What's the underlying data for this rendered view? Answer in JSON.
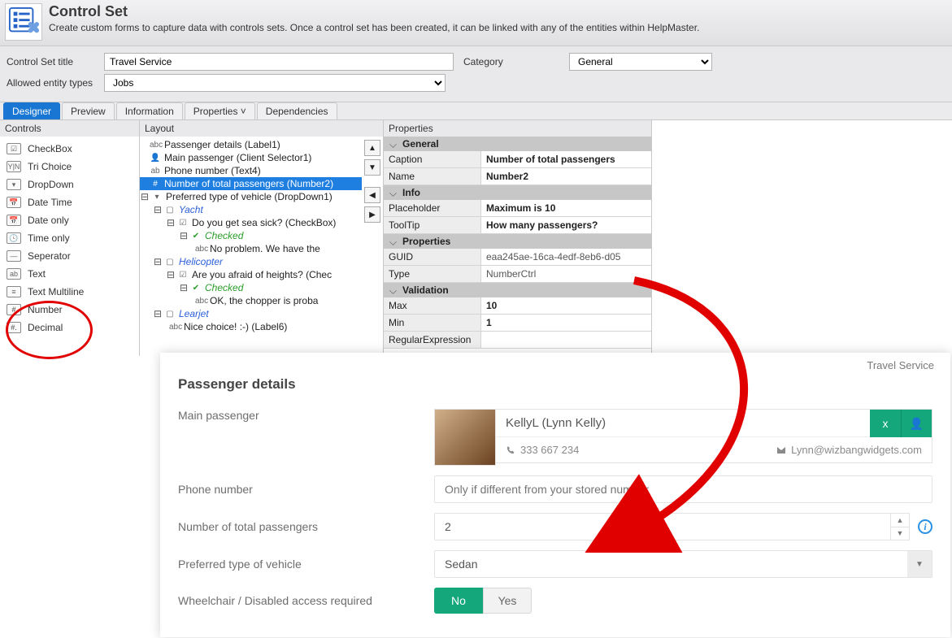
{
  "app": {
    "title": "Control Set",
    "description": "Create custom forms to capture data with controls sets.  Once a control set has been created, it can be linked with any of the entities within HelpMaster."
  },
  "config": {
    "title_label": "Control Set title",
    "title_value": "Travel Service",
    "category_label": "Category",
    "category_value": "General",
    "entity_label": "Allowed entity types",
    "entity_value": "Jobs"
  },
  "tabs": {
    "designer": "Designer",
    "preview": "Preview",
    "information": "Information",
    "properties": "Properties ˅",
    "dependencies": "Dependencies"
  },
  "panels": {
    "controls": "Controls",
    "layout": "Layout",
    "properties": "Properties"
  },
  "controls": {
    "checkbox": "CheckBox",
    "trichoice": "Tri Choice",
    "dropdown": "DropDown",
    "datetime": "Date Time",
    "dateonly": "Date only",
    "timeonly": "Time only",
    "seperator": "Seperator",
    "text": "Text",
    "multiline": "Text Multiline",
    "number": "Number",
    "decimal": "Decimal"
  },
  "layout": {
    "n0": "Passenger details (Label1)",
    "n1": "Main passenger (Client Selector1)",
    "n2": "Phone number (Text4)",
    "n3": "Number of total passengers (Number2)",
    "n4": "Preferred type of vehicle (DropDown1)",
    "yacht": "Yacht",
    "yacht_q": "Do you get sea sick? (CheckBox)",
    "yacht_checked": "Checked",
    "yacht_ok": "No problem.  We have the",
    "heli": "Helicopter",
    "heli_q": "Are you afraid of heights? (Chec",
    "heli_checked": "Checked",
    "heli_ok": "OK, the chopper is proba",
    "lear": "Learjet",
    "lear_ok": "Nice choice! :-) (Label6)"
  },
  "prop": {
    "general": "General",
    "caption_k": "Caption",
    "caption_v": "Number of total passengers",
    "name_k": "Name",
    "name_v": "Number2",
    "info": "Info",
    "ph_k": "Placeholder",
    "ph_v": "Maximum is 10",
    "tt_k": "ToolTip",
    "tt_v": "How many passengers?",
    "props": "Properties",
    "guid_k": "GUID",
    "guid_v": "eaa245ae-16ca-4edf-8eb6-d05",
    "type_k": "Type",
    "type_v": "NumberCtrl",
    "validation": "Validation",
    "max_k": "Max",
    "max_v": "10",
    "min_k": "Min",
    "min_v": "1",
    "regex_k": "RegularExpression"
  },
  "form": {
    "service": "Travel Service",
    "heading": "Passenger details",
    "main_label": "Main passenger",
    "contact_name": "KellyL (Lynn Kelly)",
    "phone": "333 667 234",
    "email": "Lynn@wizbangwidgets.com",
    "phone_label": "Phone number",
    "phone_placeholder": "Only if different from your stored number",
    "num_label": "Number of total passengers",
    "num_value": "2",
    "veh_label": "Preferred type of vehicle",
    "veh_value": "Sedan",
    "wc_label": "Wheelchair / Disabled access required",
    "toggle_no": "No",
    "toggle_yes": "Yes",
    "btn_x": "x"
  }
}
